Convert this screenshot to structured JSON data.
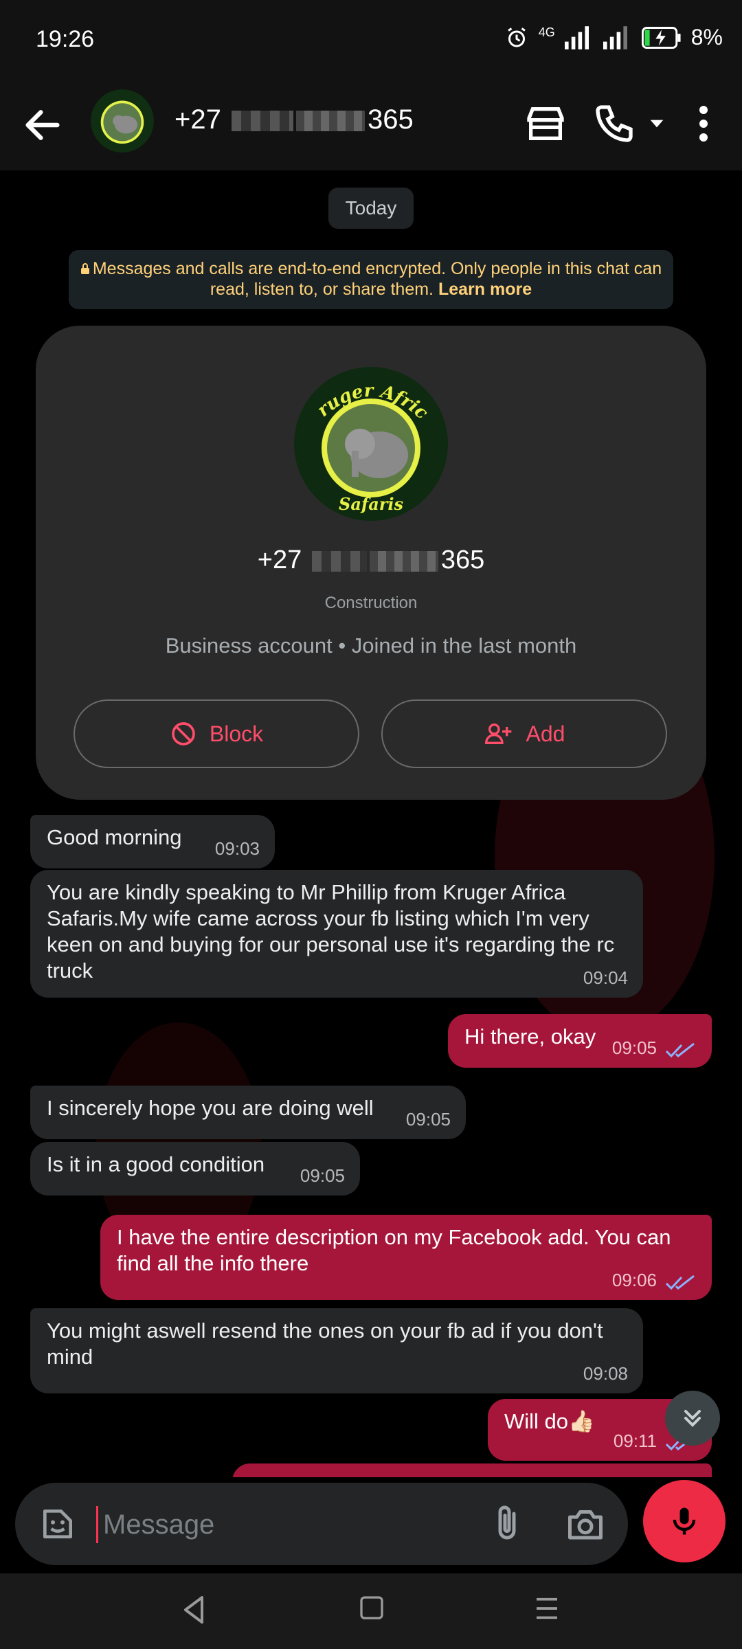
{
  "status_bar": {
    "time": "19:26",
    "network": "4G",
    "battery": "8%"
  },
  "header": {
    "title_prefix": "+27",
    "title_suffix": "365"
  },
  "chat": {
    "date_chip": "Today",
    "encryption_notice": "Messages and calls are end-to-end encrypted. Only people in this chat can read, listen to, or share them.",
    "learn_more": "Learn more",
    "profile_card": {
      "logo_text_top": "Kruger Africa",
      "logo_text_bottom": "Safaris",
      "number_prefix": "+27",
      "number_suffix": "365",
      "category": "Construction",
      "info": "Business account • Joined in the last month",
      "block_label": "Block",
      "add_label": "Add"
    },
    "messages": [
      {
        "direction": "in",
        "text": "Good morning",
        "time": "09:03"
      },
      {
        "direction": "in",
        "text": "You are kindly speaking to Mr Phillip  from Kruger Africa Safaris.My wife came across your fb listing which I'm very keen on and buying for our personal use it's regarding the rc truck",
        "time": "09:04"
      },
      {
        "direction": "out",
        "text": "Hi there, okay",
        "time": "09:05",
        "status": "read"
      },
      {
        "direction": "in",
        "text": "I sincerely hope you are doing well",
        "time": "09:05"
      },
      {
        "direction": "in",
        "text": "Is it in a good condition",
        "time": "09:05"
      },
      {
        "direction": "out",
        "text": "I have the entire description on my Facebook add. You can find all the info there",
        "time": "09:06",
        "status": "read"
      },
      {
        "direction": "in",
        "text": "You might aswell resend the ones on your fb ad if you don't mind",
        "time": "09:08"
      },
      {
        "direction": "out",
        "text": "Will do👍🏻",
        "time": "09:11",
        "status": "read"
      }
    ]
  },
  "composer": {
    "placeholder": "Message"
  },
  "colors": {
    "accent": "#ee2b45",
    "outgoing_bubble": "#a6163a",
    "incoming_bubble": "#242628",
    "read_ticks": "#8ab4ff"
  },
  "icons": [
    "back-arrow-icon",
    "store-icon",
    "phone-icon",
    "chevron-down-icon",
    "more-vert-icon",
    "lock-icon",
    "block-icon",
    "add-person-icon",
    "double-check-icon",
    "sticker-icon",
    "paperclip-icon",
    "camera-icon",
    "mic-icon",
    "double-chevron-down-icon",
    "nav-back-icon",
    "nav-home-icon",
    "nav-recents-icon"
  ]
}
